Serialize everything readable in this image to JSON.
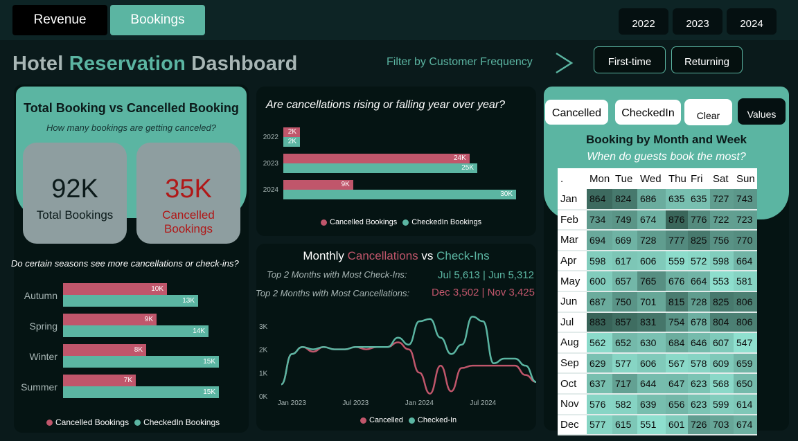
{
  "nav": {
    "tabs": [
      {
        "label": "Revenue"
      },
      {
        "label": "Bookings"
      }
    ],
    "years": [
      "2022",
      "2023",
      "2024"
    ]
  },
  "header": {
    "title_part1": "Hotel ",
    "title_accent": "Reservation",
    "title_part2": " Dashboard",
    "filter_label": "Filter by Customer Frequency",
    "filter_options": [
      "First-time",
      "Returning"
    ]
  },
  "totals": {
    "title": "Total Booking vs Cancelled Booking",
    "subtitle": "How many bookings are getting canceled?",
    "total_value": "92K",
    "total_label": "Total Bookings",
    "cancel_value": "35K",
    "cancel_label": "Cancelled Bookings"
  },
  "seasons": {
    "question": "Do certain seasons see more cancellations or check-ins?",
    "legend": [
      "Cancelled Bookings",
      "CheckedIn Bookings"
    ],
    "rows": [
      {
        "label": "Autumn",
        "cancelled": 10,
        "checkedin": 13,
        "cancelled_label": "10K",
        "checkedin_label": "13K"
      },
      {
        "label": "Spring",
        "cancelled": 9,
        "checkedin": 14,
        "cancelled_label": "9K",
        "checkedin_label": "14K"
      },
      {
        "label": "Winter",
        "cancelled": 8,
        "checkedin": 15,
        "cancelled_label": "8K",
        "checkedin_label": "15K"
      },
      {
        "label": "Summer",
        "cancelled": 7,
        "checkedin": 15,
        "cancelled_label": "7K",
        "checkedin_label": "15K"
      }
    ]
  },
  "yoy": {
    "question": "Are cancellations rising or falling year over year?",
    "legend": [
      "Cancelled Bookings",
      "CheckedIn Bookings"
    ],
    "rows": [
      {
        "label": "2022",
        "cancelled": 2,
        "checkedin": 2,
        "cancelled_label": "2K",
        "checkedin_label": "2K"
      },
      {
        "label": "2023",
        "cancelled": 24,
        "checkedin": 25,
        "cancelled_label": "24K",
        "checkedin_label": "25K"
      },
      {
        "label": "2024",
        "cancelled": 9,
        "checkedin": 30,
        "cancelled_label": "9K",
        "checkedin_label": "30K"
      }
    ]
  },
  "monthly": {
    "title_part1": "Monthly ",
    "title_cancel": "Cancellations",
    "title_vs": " vs ",
    "title_checkin": "Check-Ins",
    "top_checkin_label": "Top 2 Months with Most Check-Ins:",
    "top_checkin_value": "Jul 5,613 | Jun 5,312",
    "top_cancel_label": "Top 2 Months with Most Cancellations:",
    "top_cancel_value": "Dec 3,502 | Nov 3,425",
    "legend": [
      "Cancelled",
      "Checked-In"
    ],
    "y_ticks": [
      "3K",
      "2K",
      "1K",
      "0K"
    ],
    "x_ticks": [
      "Jan 2023",
      "Jul 2023",
      "Jan 2024",
      "Jul 2024"
    ]
  },
  "heatmap": {
    "toggles": [
      "Cancelled",
      "CheckedIn",
      "Clear",
      "Values"
    ],
    "title": "Booking by Month and Week",
    "subtitle": "When do guests book the most?",
    "corner": ".",
    "days": [
      "Mon",
      "Tue",
      "Wed",
      "Thu",
      "Fri",
      "Sat",
      "Sun"
    ],
    "rows": [
      {
        "month": "Jan",
        "values": [
          864,
          824,
          686,
          635,
          635,
          727,
          743
        ]
      },
      {
        "month": "Feb",
        "values": [
          734,
          749,
          674,
          876,
          776,
          722,
          723
        ]
      },
      {
        "month": "Mar",
        "values": [
          694,
          669,
          728,
          777,
          825,
          756,
          770
        ]
      },
      {
        "month": "Apr",
        "values": [
          598,
          617,
          606,
          559,
          572,
          598,
          664
        ]
      },
      {
        "month": "May",
        "values": [
          600,
          657,
          765,
          676,
          664,
          553,
          581
        ]
      },
      {
        "month": "Jun",
        "values": [
          687,
          750,
          701,
          815,
          728,
          825,
          806
        ]
      },
      {
        "month": "Jul",
        "values": [
          883,
          857,
          831,
          754,
          678,
          804,
          806
        ]
      },
      {
        "month": "Aug",
        "values": [
          562,
          652,
          630,
          684,
          646,
          607,
          547
        ]
      },
      {
        "month": "Sep",
        "values": [
          629,
          577,
          606,
          567,
          578,
          609,
          659
        ]
      },
      {
        "month": "Oct",
        "values": [
          637,
          717,
          644,
          647,
          623,
          568,
          650
        ]
      },
      {
        "month": "Nov",
        "values": [
          576,
          582,
          639,
          656,
          623,
          599,
          614
        ]
      },
      {
        "month": "Dec",
        "values": [
          577,
          615,
          551,
          601,
          726,
          703,
          674
        ]
      }
    ]
  },
  "chart_data": [
    {
      "type": "bar",
      "orientation": "horizontal",
      "categories": [
        "Autumn",
        "Spring",
        "Winter",
        "Summer"
      ],
      "series": [
        {
          "name": "Cancelled Bookings",
          "values": [
            10,
            9,
            8,
            7
          ]
        },
        {
          "name": "CheckedIn Bookings",
          "values": [
            13,
            14,
            15,
            15
          ]
        }
      ],
      "units": "K",
      "color_cancelled": "#c0566b",
      "color_checkedin": "#5bb5a2"
    },
    {
      "type": "bar",
      "orientation": "horizontal",
      "categories": [
        "2022",
        "2023",
        "2024"
      ],
      "series": [
        {
          "name": "Cancelled Bookings",
          "values": [
            2,
            24,
            9
          ]
        },
        {
          "name": "CheckedIn Bookings",
          "values": [
            2,
            25,
            30
          ]
        }
      ],
      "units": "K"
    },
    {
      "type": "line",
      "x": [
        "2022-12",
        "2023-01",
        "2023-02",
        "2023-03",
        "2023-04",
        "2023-05",
        "2023-06",
        "2023-07",
        "2023-08",
        "2023-09",
        "2023-10",
        "2023-11",
        "2023-12",
        "2024-01",
        "2024-02",
        "2024-03",
        "2024-04",
        "2024-05",
        "2024-06",
        "2024-07",
        "2024-08",
        "2024-09",
        "2024-10",
        "2024-11",
        "2024-12"
      ],
      "series": [
        {
          "name": "Cancelled",
          "values": [
            500,
            1800,
            2100,
            1900,
            2100,
            2000,
            2000,
            2100,
            2000,
            2100,
            2100,
            2300,
            2000,
            1000,
            100,
            1300,
            200,
            1200,
            1300,
            1300,
            1300,
            1300,
            1300,
            900,
            600
          ]
        },
        {
          "name": "Checked-In",
          "values": [
            500,
            1800,
            2100,
            2000,
            2100,
            2000,
            2000,
            2100,
            2100,
            2100,
            2100,
            2500,
            2200,
            3200,
            3300,
            2500,
            1800,
            2200,
            3400,
            3200,
            1400,
            1600,
            1600,
            1300,
            600
          ]
        }
      ],
      "y_ticks": [
        "0K",
        "1K",
        "2K",
        "3K"
      ],
      "ylim": [
        0,
        3500
      ]
    }
  ]
}
